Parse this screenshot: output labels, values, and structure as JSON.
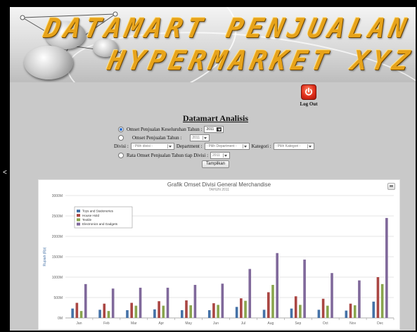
{
  "banner": {
    "line1": "DATAMART PENJUALAN",
    "line2": "HYPERMARKET XYZ"
  },
  "logout": {
    "label": "Log Out"
  },
  "nav": {
    "left_arrow": "<"
  },
  "form": {
    "title": "Datamart Analisis",
    "opt1": {
      "label": "Omset Penjualan Keseluruhan Tahun :",
      "year": "2011",
      "selected": true
    },
    "opt2": {
      "label": "Omset Penjualan Tahun :",
      "year": "2011",
      "selected": false
    },
    "filters": {
      "divisi_label": "Divisi :",
      "divisi_value": "- Pilih divisi -",
      "department_label": "Department :",
      "department_value": "- Pilih Department -",
      "kategori_label": "Kategori :",
      "kategori_value": "- Pilih Kategori -"
    },
    "opt3": {
      "label": "Rata Omset Penjualan Tahun tiap Divisi :",
      "year": "2011",
      "selected": false
    },
    "submit_label": "Tampilkan"
  },
  "chart_data": {
    "type": "bar",
    "title": "Grafik Omset Divisi General Merchandise",
    "subtitle": "TAHUN 2011",
    "ylabel": "Rupiah (Rp)",
    "ylim": [
      0,
      3000
    ],
    "yticks": [
      "0M",
      "500M",
      "1000M",
      "1500M",
      "2000M",
      "2500M",
      "3000M"
    ],
    "ytick_values": [
      0,
      500,
      1000,
      1500,
      2000,
      2500,
      3000
    ],
    "legend_position": "top-left",
    "categories": [
      "Jan",
      "Feb",
      "Mar",
      "Apr",
      "May",
      "Jun",
      "Jul",
      "Aug",
      "Sep",
      "Oct",
      "Nov",
      "Dec"
    ],
    "series": [
      {
        "name": "Toys and Stationeries",
        "color": "#4572a7",
        "values": [
          230,
          200,
          190,
          210,
          190,
          190,
          270,
          200,
          230,
          200,
          180,
          400
        ]
      },
      {
        "name": "House Hold",
        "color": "#aa4643",
        "values": [
          370,
          350,
          370,
          410,
          430,
          360,
          480,
          630,
          530,
          470,
          350,
          1000
        ]
      },
      {
        "name": "Textile",
        "color": "#89a54e",
        "values": [
          170,
          170,
          300,
          300,
          310,
          320,
          420,
          810,
          320,
          300,
          310,
          830
        ]
      },
      {
        "name": "Electronics and Gadgets",
        "color": "#80699b",
        "values": [
          830,
          720,
          740,
          740,
          810,
          840,
          1200,
          1590,
          1430,
          1100,
          920,
          2450
        ]
      }
    ]
  }
}
